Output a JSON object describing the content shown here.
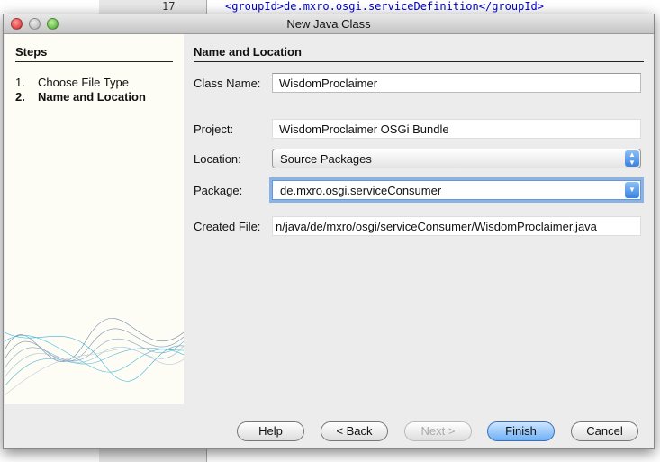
{
  "background_editor": {
    "line_number": "17",
    "code": "<groupId>de.mxro.osgi.serviceDefinition</groupId>"
  },
  "window": {
    "title": "New Java Class"
  },
  "steps": {
    "heading": "Steps",
    "items": [
      {
        "num": "1.",
        "label": "Choose File Type",
        "current": false
      },
      {
        "num": "2.",
        "label": "Name and Location",
        "current": true
      }
    ]
  },
  "main": {
    "heading": "Name and Location",
    "class_name": {
      "label": "Class Name:",
      "value": "WisdomProclaimer"
    },
    "project": {
      "label": "Project:",
      "value": "WisdomProclaimer OSGi Bundle"
    },
    "location": {
      "label": "Location:",
      "value": "Source Packages"
    },
    "package": {
      "label": "Package:",
      "value": "de.mxro.osgi.serviceConsumer"
    },
    "created_file": {
      "label": "Created File:",
      "value": "n/java/de/mxro/osgi/serviceConsumer/WisdomProclaimer.java"
    }
  },
  "buttons": {
    "help": "Help",
    "back": "< Back",
    "next": "Next >",
    "finish": "Finish",
    "cancel": "Cancel"
  }
}
